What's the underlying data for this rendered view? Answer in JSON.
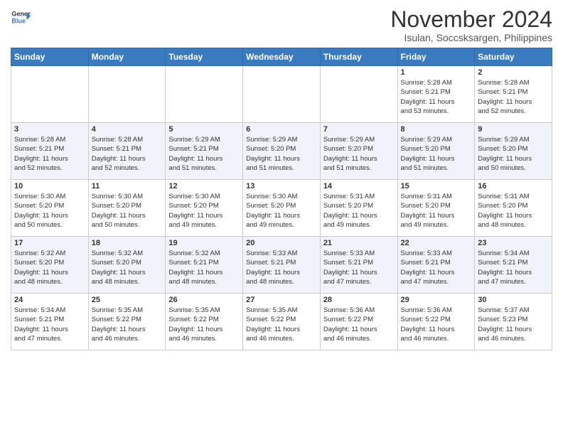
{
  "header": {
    "logo_line1": "General",
    "logo_line2": "Blue",
    "month_title": "November 2024",
    "location": "Isulan, Soccsksargen, Philippines"
  },
  "days_of_week": [
    "Sunday",
    "Monday",
    "Tuesday",
    "Wednesday",
    "Thursday",
    "Friday",
    "Saturday"
  ],
  "weeks": [
    [
      {
        "day": "",
        "info": ""
      },
      {
        "day": "",
        "info": ""
      },
      {
        "day": "",
        "info": ""
      },
      {
        "day": "",
        "info": ""
      },
      {
        "day": "",
        "info": ""
      },
      {
        "day": "1",
        "info": "Sunrise: 5:28 AM\nSunset: 5:21 PM\nDaylight: 11 hours\nand 53 minutes."
      },
      {
        "day": "2",
        "info": "Sunrise: 5:28 AM\nSunset: 5:21 PM\nDaylight: 11 hours\nand 52 minutes."
      }
    ],
    [
      {
        "day": "3",
        "info": "Sunrise: 5:28 AM\nSunset: 5:21 PM\nDaylight: 11 hours\nand 52 minutes."
      },
      {
        "day": "4",
        "info": "Sunrise: 5:28 AM\nSunset: 5:21 PM\nDaylight: 11 hours\nand 52 minutes."
      },
      {
        "day": "5",
        "info": "Sunrise: 5:29 AM\nSunset: 5:21 PM\nDaylight: 11 hours\nand 51 minutes."
      },
      {
        "day": "6",
        "info": "Sunrise: 5:29 AM\nSunset: 5:20 PM\nDaylight: 11 hours\nand 51 minutes."
      },
      {
        "day": "7",
        "info": "Sunrise: 5:29 AM\nSunset: 5:20 PM\nDaylight: 11 hours\nand 51 minutes."
      },
      {
        "day": "8",
        "info": "Sunrise: 5:29 AM\nSunset: 5:20 PM\nDaylight: 11 hours\nand 51 minutes."
      },
      {
        "day": "9",
        "info": "Sunrise: 5:29 AM\nSunset: 5:20 PM\nDaylight: 11 hours\nand 50 minutes."
      }
    ],
    [
      {
        "day": "10",
        "info": "Sunrise: 5:30 AM\nSunset: 5:20 PM\nDaylight: 11 hours\nand 50 minutes."
      },
      {
        "day": "11",
        "info": "Sunrise: 5:30 AM\nSunset: 5:20 PM\nDaylight: 11 hours\nand 50 minutes."
      },
      {
        "day": "12",
        "info": "Sunrise: 5:30 AM\nSunset: 5:20 PM\nDaylight: 11 hours\nand 49 minutes."
      },
      {
        "day": "13",
        "info": "Sunrise: 5:30 AM\nSunset: 5:20 PM\nDaylight: 11 hours\nand 49 minutes."
      },
      {
        "day": "14",
        "info": "Sunrise: 5:31 AM\nSunset: 5:20 PM\nDaylight: 11 hours\nand 49 minutes."
      },
      {
        "day": "15",
        "info": "Sunrise: 5:31 AM\nSunset: 5:20 PM\nDaylight: 11 hours\nand 49 minutes."
      },
      {
        "day": "16",
        "info": "Sunrise: 5:31 AM\nSunset: 5:20 PM\nDaylight: 11 hours\nand 48 minutes."
      }
    ],
    [
      {
        "day": "17",
        "info": "Sunrise: 5:32 AM\nSunset: 5:20 PM\nDaylight: 11 hours\nand 48 minutes."
      },
      {
        "day": "18",
        "info": "Sunrise: 5:32 AM\nSunset: 5:20 PM\nDaylight: 11 hours\nand 48 minutes."
      },
      {
        "day": "19",
        "info": "Sunrise: 5:32 AM\nSunset: 5:21 PM\nDaylight: 11 hours\nand 48 minutes."
      },
      {
        "day": "20",
        "info": "Sunrise: 5:33 AM\nSunset: 5:21 PM\nDaylight: 11 hours\nand 48 minutes."
      },
      {
        "day": "21",
        "info": "Sunrise: 5:33 AM\nSunset: 5:21 PM\nDaylight: 11 hours\nand 47 minutes."
      },
      {
        "day": "22",
        "info": "Sunrise: 5:33 AM\nSunset: 5:21 PM\nDaylight: 11 hours\nand 47 minutes."
      },
      {
        "day": "23",
        "info": "Sunrise: 5:34 AM\nSunset: 5:21 PM\nDaylight: 11 hours\nand 47 minutes."
      }
    ],
    [
      {
        "day": "24",
        "info": "Sunrise: 5:34 AM\nSunset: 5:21 PM\nDaylight: 11 hours\nand 47 minutes."
      },
      {
        "day": "25",
        "info": "Sunrise: 5:35 AM\nSunset: 5:22 PM\nDaylight: 11 hours\nand 46 minutes."
      },
      {
        "day": "26",
        "info": "Sunrise: 5:35 AM\nSunset: 5:22 PM\nDaylight: 11 hours\nand 46 minutes."
      },
      {
        "day": "27",
        "info": "Sunrise: 5:35 AM\nSunset: 5:22 PM\nDaylight: 11 hours\nand 46 minutes."
      },
      {
        "day": "28",
        "info": "Sunrise: 5:36 AM\nSunset: 5:22 PM\nDaylight: 11 hours\nand 46 minutes."
      },
      {
        "day": "29",
        "info": "Sunrise: 5:36 AM\nSunset: 5:22 PM\nDaylight: 11 hours\nand 46 minutes."
      },
      {
        "day": "30",
        "info": "Sunrise: 5:37 AM\nSunset: 5:23 PM\nDaylight: 11 hours\nand 46 minutes."
      }
    ]
  ]
}
